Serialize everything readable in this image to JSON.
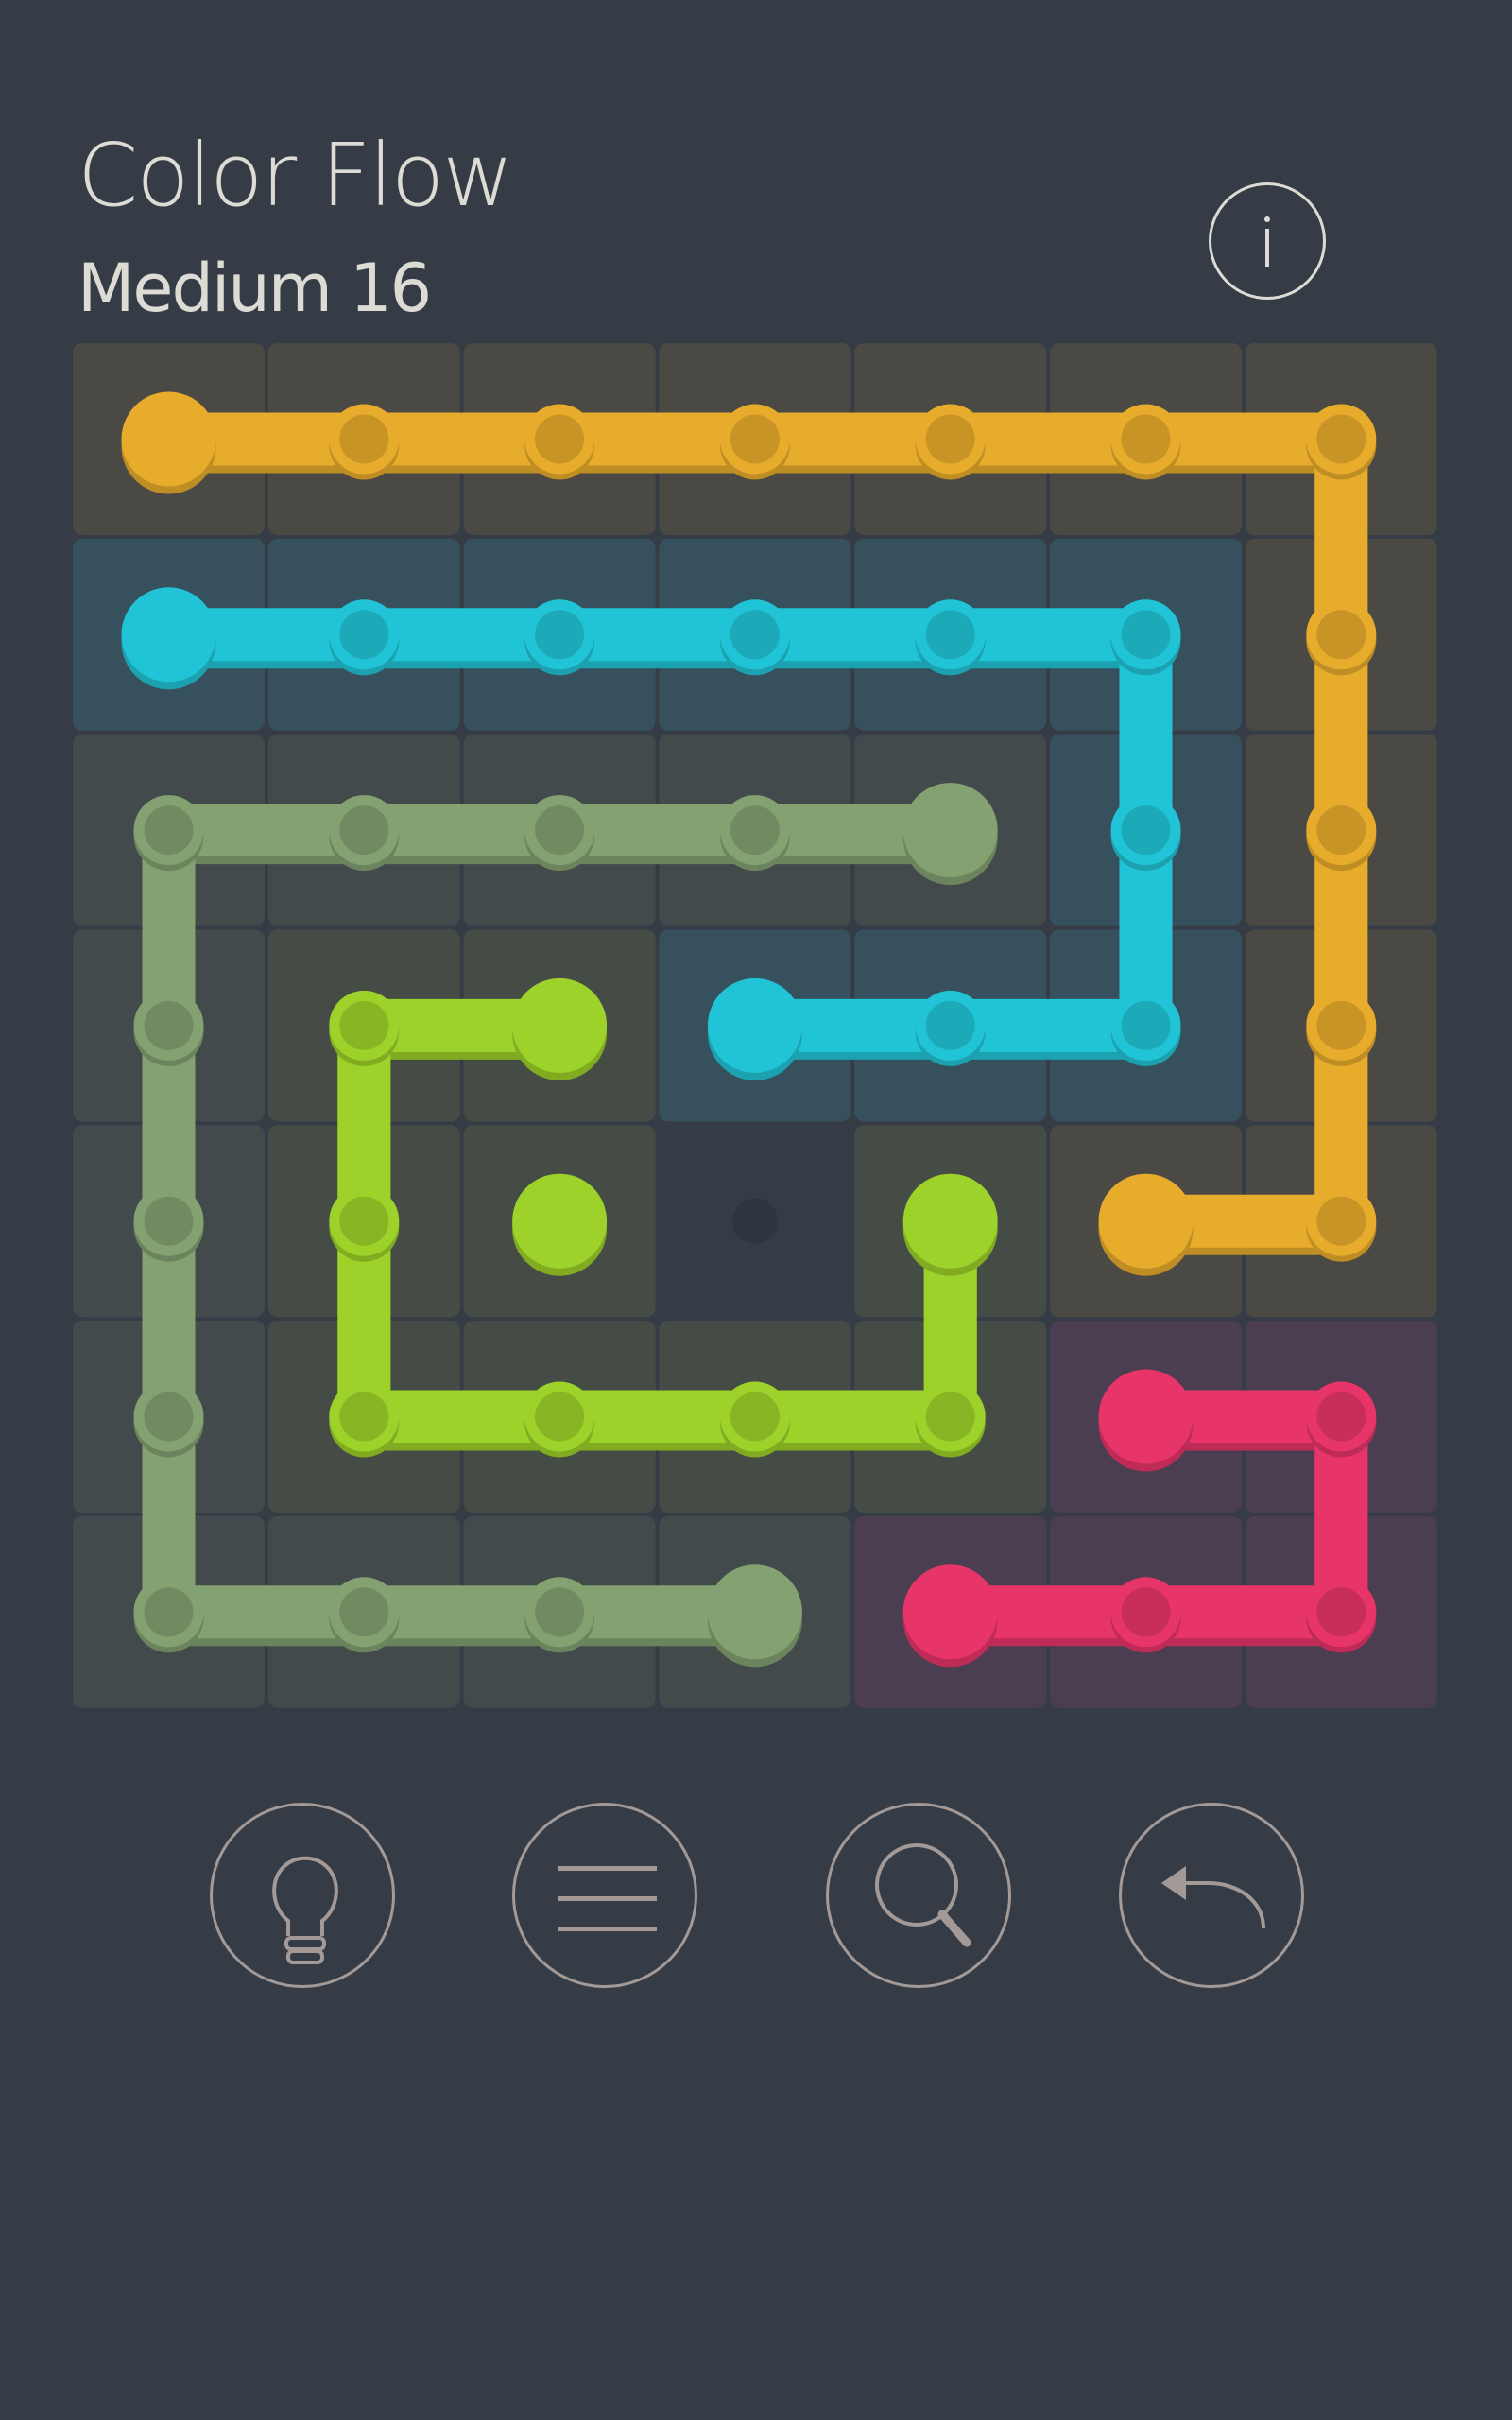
{
  "header": {
    "title": "Color Flow",
    "level": "Medium 16"
  },
  "controls": [
    {
      "name": "hint-button",
      "icon": "lightbulb-icon"
    },
    {
      "name": "menu-button",
      "icon": "menu-icon"
    },
    {
      "name": "zoom-button",
      "icon": "magnifier-icon"
    },
    {
      "name": "undo-button",
      "icon": "undo-icon"
    }
  ],
  "info_icon": "info-icon",
  "board": {
    "rows": 7,
    "cols": 7,
    "colors": {
      "orange": "#e8ac2c",
      "cyan": "#21c4d6",
      "sage": "#84a172",
      "lime": "#9dd22a",
      "pink": "#e83569"
    },
    "tints": {
      "orange": "#4a4944",
      "cyan": "#36505d",
      "sage": "#434a4b",
      "lime": "#454c46",
      "pink": "#4b3e50",
      "empty": "#363c46"
    },
    "flows": [
      {
        "color": "orange",
        "path": [
          [
            0,
            0
          ],
          [
            0,
            1
          ],
          [
            0,
            2
          ],
          [
            0,
            3
          ],
          [
            0,
            4
          ],
          [
            0,
            5
          ],
          [
            0,
            6
          ],
          [
            1,
            6
          ],
          [
            2,
            6
          ],
          [
            3,
            6
          ],
          [
            4,
            6
          ],
          [
            4,
            5
          ]
        ]
      },
      {
        "color": "cyan",
        "path": [
          [
            1,
            0
          ],
          [
            1,
            1
          ],
          [
            1,
            2
          ],
          [
            1,
            3
          ],
          [
            1,
            4
          ],
          [
            1,
            5
          ],
          [
            2,
            5
          ],
          [
            3,
            5
          ],
          [
            3,
            4
          ],
          [
            3,
            3
          ]
        ]
      },
      {
        "color": "sage",
        "path": [
          [
            2,
            4
          ],
          [
            2,
            3
          ],
          [
            2,
            2
          ],
          [
            2,
            1
          ],
          [
            2,
            0
          ],
          [
            3,
            0
          ],
          [
            4,
            0
          ],
          [
            5,
            0
          ],
          [
            6,
            0
          ],
          [
            6,
            1
          ],
          [
            6,
            2
          ],
          [
            6,
            3
          ]
        ]
      },
      {
        "color": "lime",
        "path": [
          [
            3,
            2
          ],
          [
            3,
            1
          ],
          [
            4,
            1
          ],
          [
            5,
            1
          ],
          [
            5,
            2
          ],
          [
            5,
            3
          ],
          [
            5,
            4
          ],
          [
            4,
            4
          ]
        ]
      },
      {
        "color": "pink",
        "path": [
          [
            5,
            5
          ],
          [
            5,
            6
          ],
          [
            6,
            6
          ],
          [
            6,
            5
          ],
          [
            6,
            4
          ]
        ]
      }
    ],
    "endpoints_only": [
      {
        "color": "lime",
        "cell": [
          4,
          2
        ]
      }
    ],
    "empty_cells": [
      [
        4,
        3
      ]
    ]
  }
}
